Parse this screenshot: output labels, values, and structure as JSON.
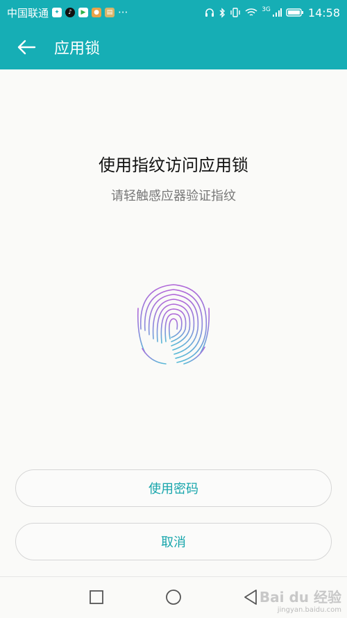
{
  "status_bar": {
    "carrier": "中国联通",
    "network": "3G",
    "time": "14:58"
  },
  "app_bar": {
    "title": "应用锁"
  },
  "main": {
    "heading": "使用指纹访问应用锁",
    "subheading": "请轻触感应器验证指纹"
  },
  "actions": {
    "use_password": "使用密码",
    "cancel": "取消"
  },
  "watermark": {
    "brand": "Bai du 经验",
    "url": "jingyan.baidu.com"
  },
  "colors": {
    "accent": "#16aeb5",
    "button_text": "#16a5ab"
  },
  "icons": [
    "back-arrow-icon",
    "fingerprint-icon",
    "recent-apps-icon",
    "home-icon",
    "back-triangle-icon"
  ]
}
